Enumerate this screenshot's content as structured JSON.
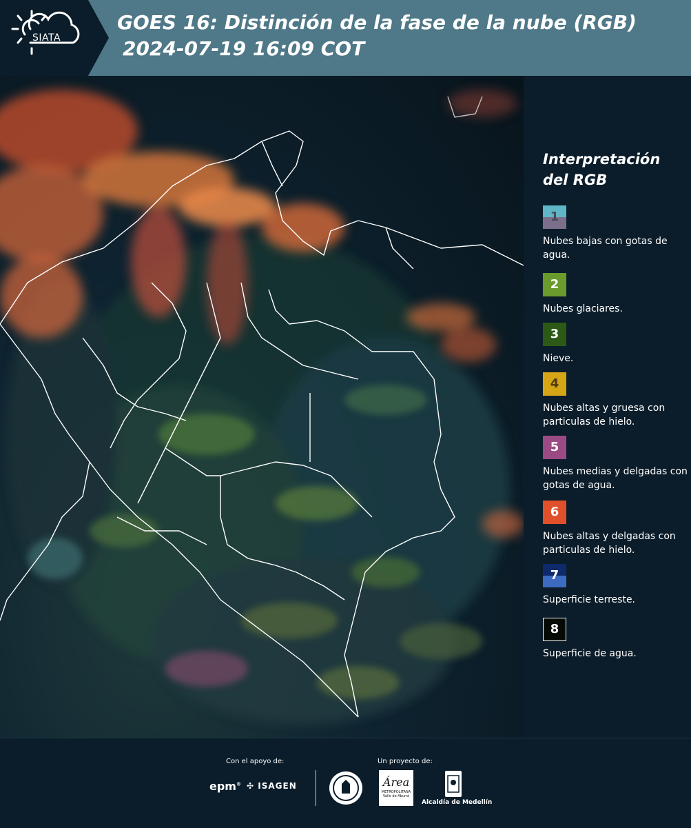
{
  "header": {
    "logo_text": "SIATA",
    "title_line1": "GOES 16: Distinción de la fase de la nube (RGB)",
    "title_line2": "2024-07-19 16:09 COT"
  },
  "legend": {
    "title": "Interpretación del RGB",
    "items": [
      {
        "num": "1",
        "top": "#5fb6c6",
        "bottom": "#7b6f8c",
        "label": "Nubes bajas con gotas de agua.",
        "text_color": "#4a4a55"
      },
      {
        "num": "2",
        "color": "#6a9b2c",
        "label": "Nubes glaciares."
      },
      {
        "num": "3",
        "color": "#2c5a16",
        "label": "Nieve."
      },
      {
        "num": "4",
        "color": "#d6a516",
        "label": "Nubes altas y gruesa con particulas de hielo.",
        "text_color": "#4a3a10"
      },
      {
        "num": "5",
        "color": "#9b4a83",
        "label": "Nubes medias y delgadas con gotas de agua."
      },
      {
        "num": "6",
        "color": "#e0502a",
        "label": "Nubes altas y delgadas con particulas de hielo."
      },
      {
        "num": "7",
        "top": "#0e2a6a",
        "bottom": "#3d6bc2",
        "label": "Superficie terreste."
      },
      {
        "num": "8",
        "color": "#050a05",
        "label": "Superficie de agua.",
        "border": "#ffffff"
      }
    ]
  },
  "footer": {
    "support_label": "Con el apoyo de:",
    "project_label": "Un proyecto de:",
    "epm": "epm",
    "isagen": "ISAGEN",
    "area_top": "Área",
    "area_sub": "METROPOLITANA",
    "area_sub2": "Valle de Aburrá",
    "alcaldia": "Alcaldía de Medellín"
  }
}
